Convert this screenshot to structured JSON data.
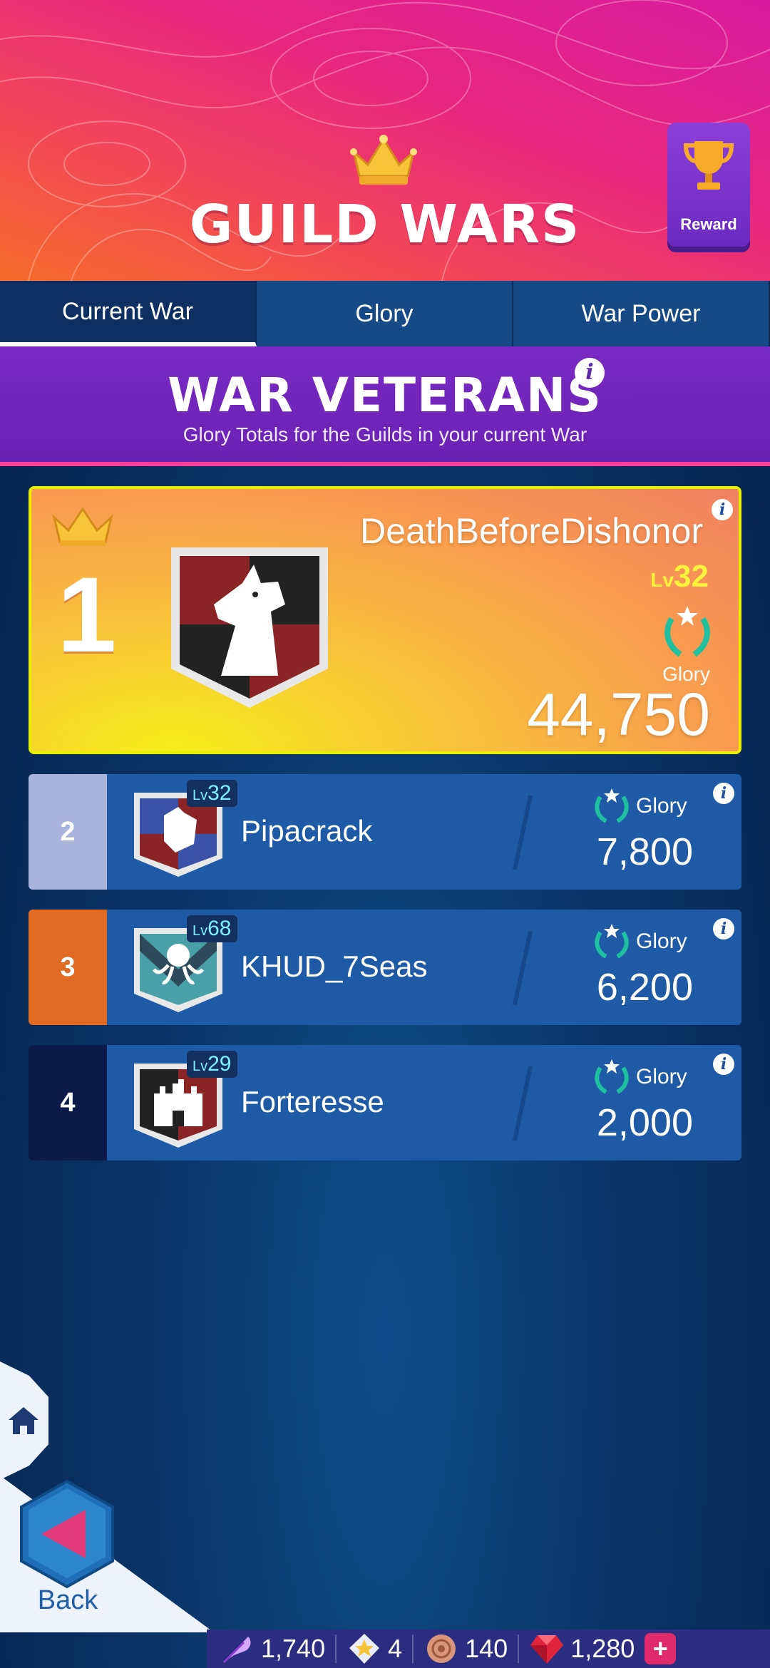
{
  "header": {
    "title": "GUILD WARS",
    "reward_label": "Reward",
    "icons": {
      "crown": "crown-icon",
      "reward": "trophy-icon"
    }
  },
  "tabs": [
    {
      "label": "Current War",
      "active": true
    },
    {
      "label": "Glory",
      "active": false
    },
    {
      "label": "War Power",
      "active": false
    }
  ],
  "section": {
    "title": "WAR VETERANS",
    "subtitle": "Glory Totals for the Guilds in your current War",
    "info": "i"
  },
  "leader": {
    "rank": "1",
    "name": "DeathBeforeDishonor",
    "lv_prefix": "Lv",
    "level": "32",
    "glory_label": "Glory",
    "glory_value": "44,750",
    "info": "i"
  },
  "rows": [
    {
      "rank": "2",
      "lv_prefix": "Lv",
      "level": "32",
      "name": "Pipacrack",
      "glory_label": "Glory",
      "glory_value": "7,800",
      "info": "i",
      "rank_color": "#a9b4dc"
    },
    {
      "rank": "3",
      "lv_prefix": "Lv",
      "level": "68",
      "name": "KHUD_7Seas",
      "glory_label": "Glory",
      "glory_value": "6,200",
      "info": "i",
      "rank_color": "#e06a22"
    },
    {
      "rank": "4",
      "lv_prefix": "Lv",
      "level": "29",
      "name": "Forteresse",
      "glory_label": "Glory",
      "glory_value": "2,000",
      "info": "i",
      "rank_color": "#0c1a4a"
    }
  ],
  "nav": {
    "back_label": "Back",
    "icons": {
      "home": "home-icon",
      "back": "back-arrow-icon"
    }
  },
  "currencies": [
    {
      "icon": "feather-icon",
      "value": "1,740"
    },
    {
      "icon": "star-icon",
      "value": "4"
    },
    {
      "icon": "seal-icon",
      "value": "140"
    },
    {
      "icon": "gem-icon",
      "value": "1,280"
    }
  ],
  "add_currency": "+"
}
